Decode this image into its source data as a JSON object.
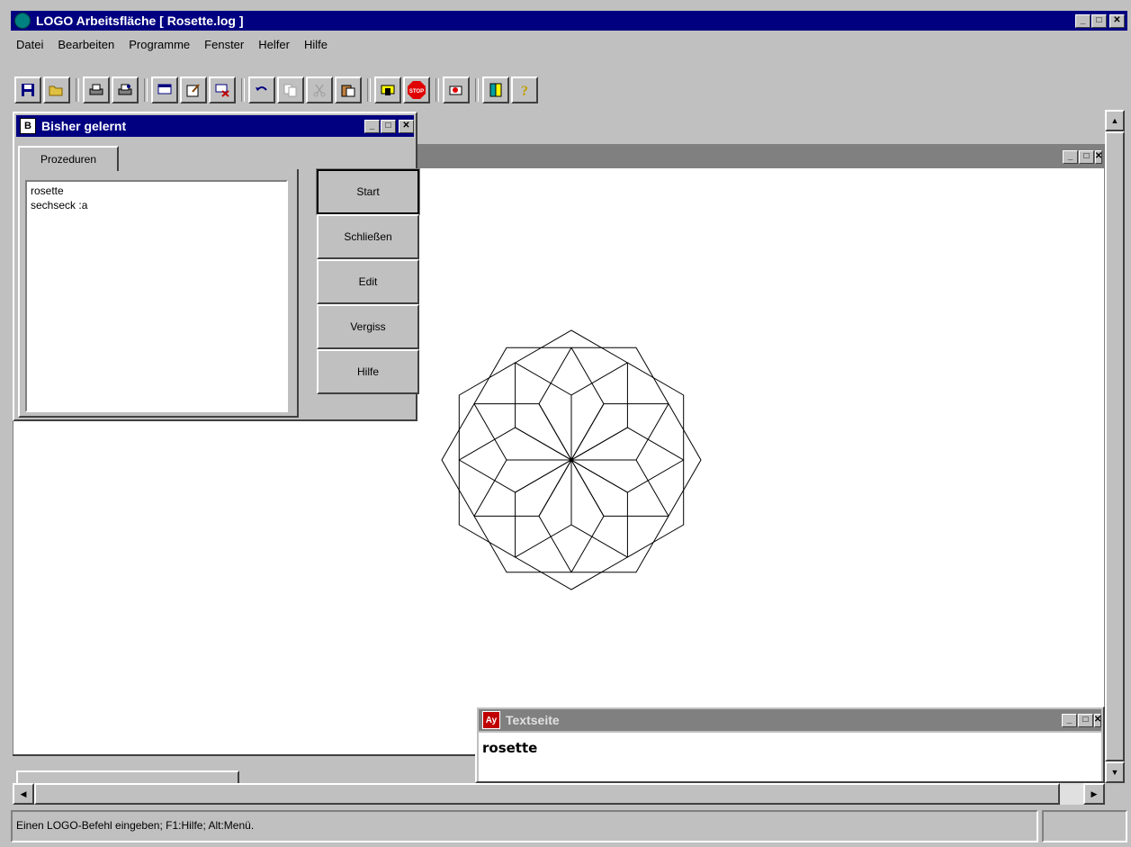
{
  "app": {
    "title": "LOGO Arbeitsfläche [ Rosette.log ]",
    "colors": {
      "titlebar_active": "#000080",
      "titlebar_inactive": "#808080",
      "face": "#c0c0c0"
    }
  },
  "menu": {
    "items": [
      "Datei",
      "Bearbeiten",
      "Programme",
      "Fenster",
      "Helfer",
      "Hilfe"
    ]
  },
  "toolbar": {
    "icons": [
      "save-icon",
      "open-folder-icon",
      "print-icon",
      "print-preview-icon",
      "new-window-icon",
      "edit-procedure-icon",
      "delete-procedure-icon",
      "undo-icon",
      "copy-icon",
      "cut-icon",
      "paste-icon",
      "run-icon",
      "stop-icon",
      "erase-icon",
      "window-icon",
      "help-icon"
    ],
    "stop_label": "STOP"
  },
  "learned_window": {
    "title": "Bisher gelernt",
    "tab": "Prozeduren",
    "procedures": [
      "rosette",
      "sechseck :a"
    ],
    "buttons": [
      "Start",
      "Schließen",
      "Edit",
      "Vergiss",
      "Hilfe"
    ]
  },
  "text_window": {
    "title": "Textseite",
    "content": "rosette"
  },
  "statusbar": {
    "text": "Einen LOGO-Befehl eingeben; F1:Hilfe; Alt:Menü."
  }
}
